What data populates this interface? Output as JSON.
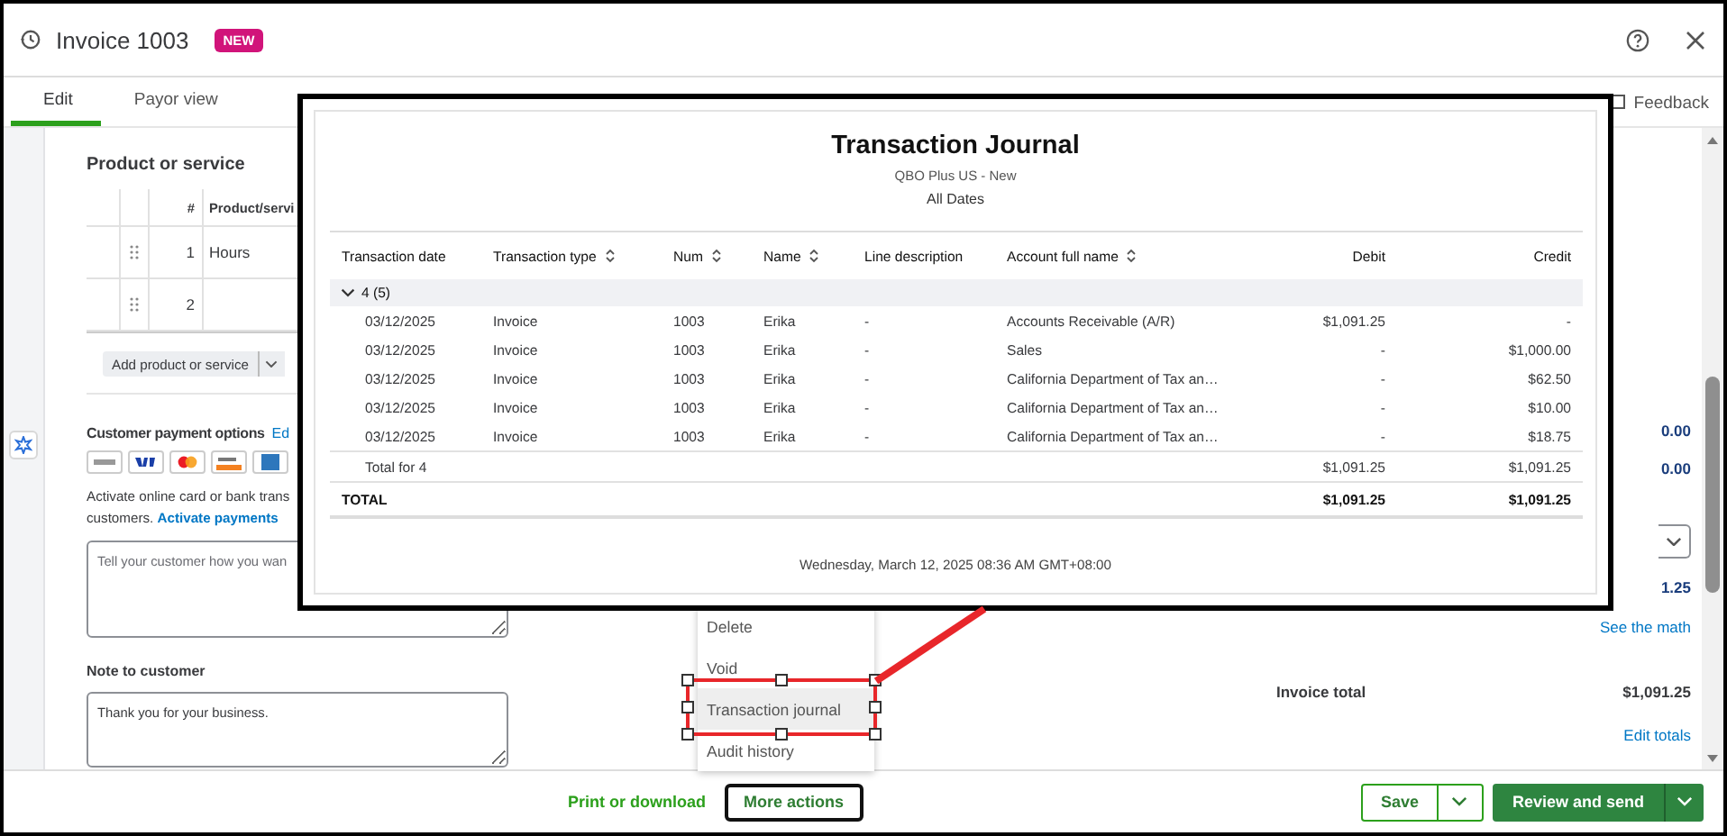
{
  "header": {
    "title": "Invoice 1003",
    "badge": "NEW"
  },
  "tabs": [
    {
      "label": "Edit",
      "selected": true
    },
    {
      "label": "Payor view",
      "selected": false
    }
  ],
  "feedback": "Feedback",
  "products": {
    "heading": "Product or service",
    "columns": [
      "#",
      "Product/servi"
    ],
    "rows": [
      {
        "number": "1",
        "item": "Hours"
      },
      {
        "number": "2"
      }
    ],
    "add_button": "Add product or service"
  },
  "payment": {
    "heading": "Customer payment options",
    "edit_link": "Ed",
    "message_line_1": "Activate online card or bank trans",
    "message_line_2": "customers.",
    "activate_link": "Activate payments",
    "placeholder": "Tell your customer how you wan"
  },
  "note": {
    "label": "Note to customer",
    "value": "Thank you for your business."
  },
  "totals": {
    "amount_1": "0.00",
    "amount_2": "0.00",
    "amount_3": "1.25",
    "see_math": "See the math",
    "invoice_total_label": "Invoice total",
    "invoice_total": "$1,091.25",
    "edit_totals": "Edit totals"
  },
  "menu": [
    {
      "label": "Delete",
      "selected": false
    },
    {
      "label": "Void",
      "selected": false
    },
    {
      "label": "Transaction journal",
      "selected": true
    },
    {
      "label": "Audit history",
      "selected": false
    }
  ],
  "journal": {
    "title": "Transaction Journal",
    "company": "QBO Plus US - New",
    "period": "All Dates",
    "columns": [
      {
        "label": "Transaction date",
        "sortable": false
      },
      {
        "label": "Transaction type",
        "sortable": true
      },
      {
        "label": "Num",
        "sortable": true
      },
      {
        "label": "Name",
        "sortable": true
      },
      {
        "label": "Line description",
        "sortable": false
      },
      {
        "label": "Account full name",
        "sortable": true
      },
      {
        "label": "Debit",
        "sortable": false
      },
      {
        "label": "Credit",
        "sortable": false
      }
    ],
    "group": {
      "label": "4 (5)",
      "expanded": true
    },
    "rows": [
      [
        "03/12/2025",
        "Invoice",
        "1003",
        "Erika",
        "-",
        "Accounts Receivable (A/R)",
        "$1,091.25",
        "-"
      ],
      [
        "03/12/2025",
        "Invoice",
        "1003",
        "Erika",
        "-",
        "Sales",
        "-",
        "$1,000.00"
      ],
      [
        "03/12/2025",
        "Invoice",
        "1003",
        "Erika",
        "-",
        "California Department of Tax an…",
        "-",
        "$62.50"
      ],
      [
        "03/12/2025",
        "Invoice",
        "1003",
        "Erika",
        "-",
        "California Department of Tax an…",
        "-",
        "$10.00"
      ],
      [
        "03/12/2025",
        "Invoice",
        "1003",
        "Erika",
        "-",
        "California Department of Tax an…",
        "-",
        "$18.75"
      ]
    ],
    "group_total": {
      "label": "Total for 4",
      "debit": "$1,091.25",
      "credit": "$1,091.25"
    },
    "total": {
      "label": "TOTAL",
      "debit": "$1,091.25",
      "credit": "$1,091.25"
    },
    "timestamp": "Wednesday, March 12, 2025 08:36 AM GMT+08:00"
  },
  "footer": {
    "print": "Print or download",
    "more": "More actions",
    "save": "Save",
    "review": "Review and send"
  }
}
